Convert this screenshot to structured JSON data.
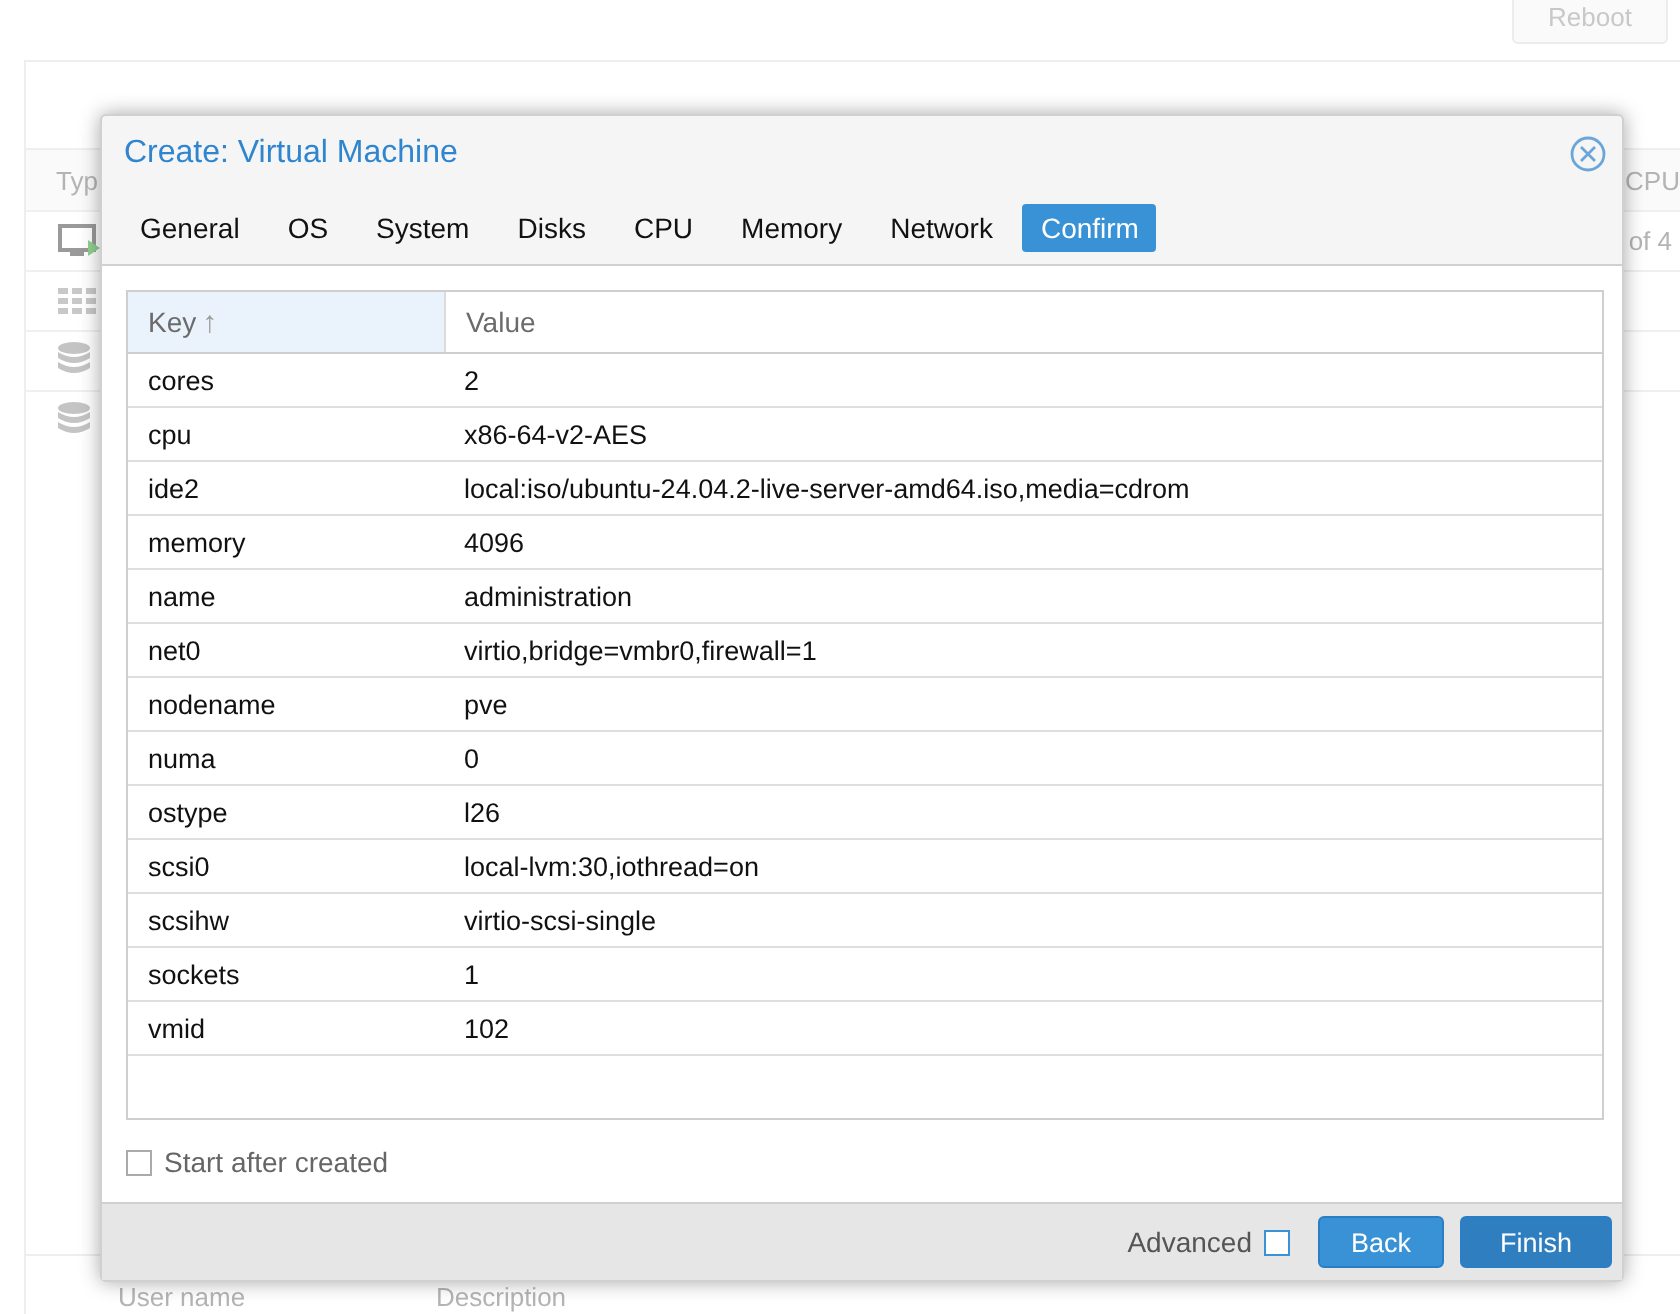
{
  "background": {
    "reboot_button": "Reboot",
    "header": {
      "column_1": "Typ",
      "column_2": "CPU"
    },
    "pager": "of 4",
    "rows": [
      {
        "kind": "vm"
      },
      {
        "kind": "grid"
      },
      {
        "kind": "storage"
      },
      {
        "kind": "storage"
      }
    ],
    "bottom_columns": [
      "User name",
      "Description"
    ]
  },
  "dialog": {
    "title": "Create: Virtual Machine",
    "tabs": [
      {
        "label": "General",
        "selected": false
      },
      {
        "label": "OS",
        "selected": false
      },
      {
        "label": "System",
        "selected": false
      },
      {
        "label": "Disks",
        "selected": false
      },
      {
        "label": "CPU",
        "selected": false
      },
      {
        "label": "Memory",
        "selected": false
      },
      {
        "label": "Network",
        "selected": false
      },
      {
        "label": "Confirm",
        "selected": true
      }
    ],
    "table": {
      "columns": [
        {
          "label": "Key",
          "sort_indicator": "↑"
        },
        {
          "label": "Value"
        }
      ],
      "rows": [
        [
          "cores",
          "2"
        ],
        [
          "cpu",
          "x86-64-v2-AES"
        ],
        [
          "ide2",
          "local:iso/ubuntu-24.04.2-live-server-amd64.iso,media=cdrom"
        ],
        [
          "memory",
          "4096"
        ],
        [
          "name",
          "administration"
        ],
        [
          "net0",
          "virtio,bridge=vmbr0,firewall=1"
        ],
        [
          "nodename",
          "pve"
        ],
        [
          "numa",
          "0"
        ],
        [
          "ostype",
          "l26"
        ],
        [
          "scsi0",
          "local-lvm:30,iothread=on"
        ],
        [
          "scsihw",
          "virtio-scsi-single"
        ],
        [
          "sockets",
          "1"
        ],
        [
          "vmid",
          "102"
        ]
      ]
    },
    "start_after_created": {
      "label": "Start after created",
      "checked": false
    },
    "advanced": {
      "label": "Advanced",
      "checked": false
    },
    "buttons": [
      "Back",
      "Finish"
    ]
  }
}
